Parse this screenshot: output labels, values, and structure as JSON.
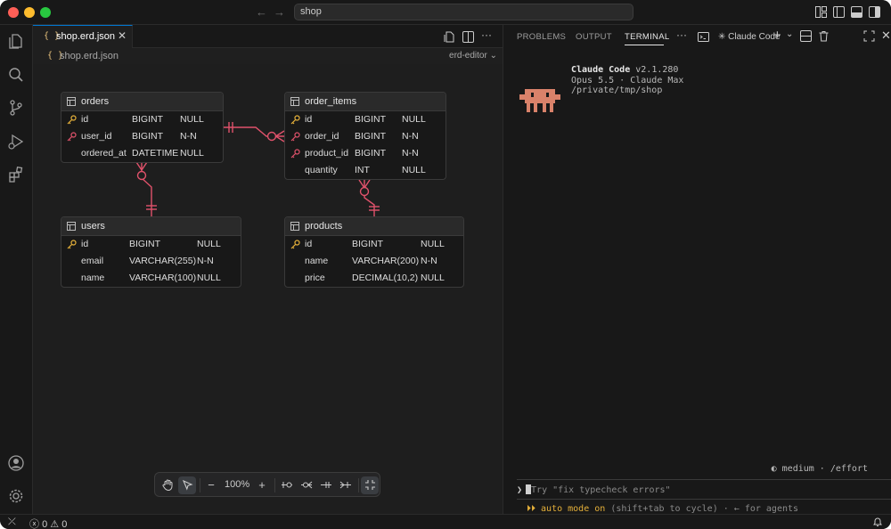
{
  "titlebar": {
    "search_text": "shop",
    "icons": [
      "arrow-left-icon",
      "arrow-right-icon",
      "layout-customize-icon",
      "toggle-sidebar-icon",
      "toggle-panel-icon",
      "toggle-secondary-sidebar-icon"
    ]
  },
  "activitybar": {
    "items": [
      "explorer-icon",
      "search-icon",
      "source-control-icon",
      "run-debug-icon",
      "extensions-icon"
    ],
    "bottom": [
      "account-icon",
      "settings-gear-icon"
    ]
  },
  "editor": {
    "tab": {
      "label": "shop.erd.json",
      "glyph": "{ }"
    },
    "breadcrumb": "shop.erd.json",
    "editor_kind": "erd-editor",
    "tables": {
      "orders": {
        "name": "orders",
        "columns": [
          {
            "name": "id",
            "type": "BIGINT",
            "null": "NULL",
            "key": "primary"
          },
          {
            "name": "user_id",
            "type": "BIGINT",
            "null": "N-N",
            "key": "foreign"
          },
          {
            "name": "ordered_at",
            "type": "DATETIME",
            "null": "NULL",
            "key": ""
          }
        ]
      },
      "order_items": {
        "name": "order_items",
        "columns": [
          {
            "name": "id",
            "type": "BIGINT",
            "null": "NULL",
            "key": "primary"
          },
          {
            "name": "order_id",
            "type": "BIGINT",
            "null": "N-N",
            "key": "foreign"
          },
          {
            "name": "product_id",
            "type": "BIGINT",
            "null": "N-N",
            "key": "foreign"
          },
          {
            "name": "quantity",
            "type": "INT",
            "null": "NULL",
            "key": ""
          }
        ]
      },
      "users": {
        "name": "users",
        "columns": [
          {
            "name": "id",
            "type": "BIGINT",
            "null": "NULL",
            "key": "primary"
          },
          {
            "name": "email",
            "type": "VARCHAR(255)",
            "null": "N-N",
            "key": ""
          },
          {
            "name": "name",
            "type": "VARCHAR(100)",
            "null": "NULL",
            "key": ""
          }
        ]
      },
      "products": {
        "name": "products",
        "columns": [
          {
            "name": "id",
            "type": "BIGINT",
            "null": "NULL",
            "key": "primary"
          },
          {
            "name": "name",
            "type": "VARCHAR(200)",
            "null": "N-N",
            "key": ""
          },
          {
            "name": "price",
            "type": "DECIMAL(10,2)",
            "null": "NULL",
            "key": ""
          }
        ]
      }
    },
    "zoom": {
      "level": "100%",
      "minus": "−",
      "plus": "+"
    }
  },
  "panel": {
    "tabs": [
      "PROBLEMS",
      "OUTPUT",
      "TERMINAL"
    ],
    "active_tab": "TERMINAL",
    "more": "···",
    "terminal_name": "✳ Claude Code",
    "claude": {
      "title": "Claude Code",
      "version": "v2.1.280",
      "line2": "Opus 5.5 · Claude Max",
      "line3": "/private/tmp/shop"
    },
    "effort": "◐ medium · /effort",
    "prompt_symbol": "❯",
    "prompt_hint": "Try \"fix typecheck errors\"",
    "mode_arrows": "⏵⏵",
    "mode_on": "auto mode on",
    "mode_rest": "(shift+tab to cycle) · ← for agents"
  },
  "statusbar": {
    "errors": "0",
    "warnings": "0"
  },
  "colors": {
    "accent": "#0078d4",
    "relation": "#e0526b",
    "primary_key": "#e5b03a",
    "foreign_key": "#e0526b",
    "mode": "#e5b03a",
    "mascot": "#d9826a"
  }
}
